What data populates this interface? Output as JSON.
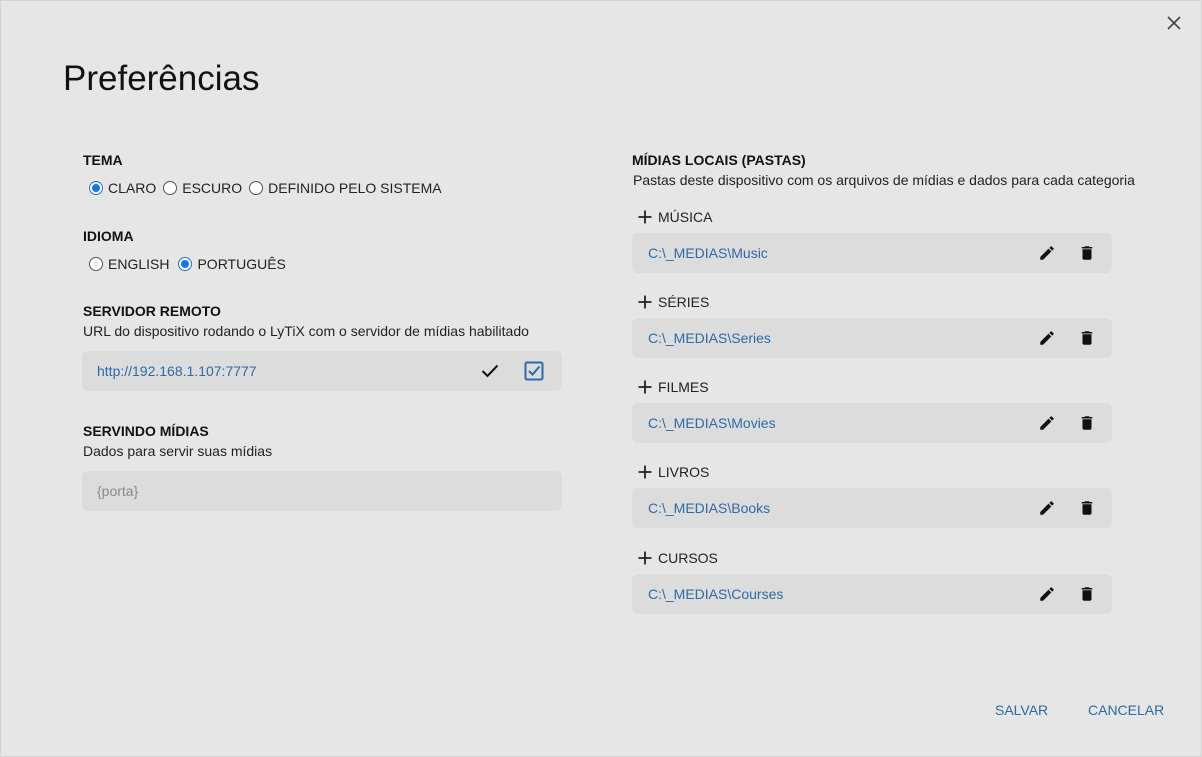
{
  "dialog": {
    "title": "Preferências"
  },
  "theme": {
    "title": "TEMA",
    "options": [
      "CLARO",
      "ESCURO",
      "DEFINIDO PELO SISTEMA"
    ],
    "selected": "CLARO"
  },
  "language": {
    "title": "IDIOMA",
    "options": [
      "ENGLISH",
      "PORTUGUÊS"
    ],
    "selected": "PORTUGUÊS"
  },
  "remote_server": {
    "title": "SERVIDOR REMOTO",
    "description": "URL do dispositivo rodando o LyTiX com o servidor de mídias habilitado",
    "url_value": "http://192.168.1.107:7777"
  },
  "serving": {
    "title": "SERVINDO MÍDIAS",
    "description": "Dados para servir suas mídias",
    "port_placeholder": "{porta}"
  },
  "local_media": {
    "title": "MÍDIAS LOCAIS (PASTAS)",
    "description": "Pastas deste dispositivo com os arquivos de mídias e dados para cada categoria",
    "categories": [
      {
        "label": "MÚSICA",
        "path": "C:\\_MEDIAS\\Music"
      },
      {
        "label": "SÉRIES",
        "path": "C:\\_MEDIAS\\Series"
      },
      {
        "label": "FILMES",
        "path": "C:\\_MEDIAS\\Movies"
      },
      {
        "label": "LIVROS",
        "path": "C:\\_MEDIAS\\Books"
      },
      {
        "label": "CURSOS",
        "path": "C:\\_MEDIAS\\Courses"
      }
    ]
  },
  "actions": {
    "save": "SALVAR",
    "cancel": "CANCELAR"
  },
  "colors": {
    "accent": "#1a73e8",
    "link": "#2d6aa8",
    "background": "#e6e6e6",
    "field": "#dcdcdc"
  },
  "icons": [
    "close-icon",
    "plus-icon",
    "pencil-icon",
    "trash-icon",
    "check-icon",
    "checkbox-checked-icon"
  ]
}
